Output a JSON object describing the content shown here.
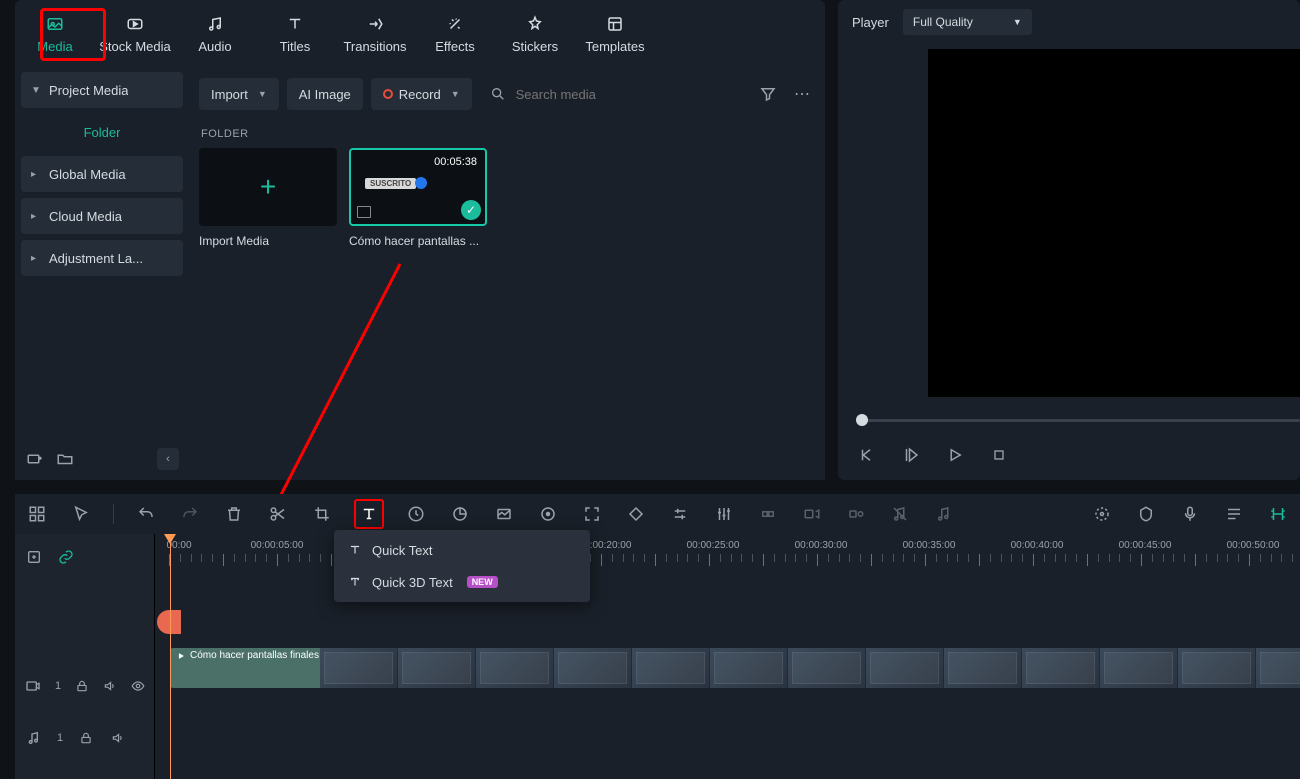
{
  "top_tabs": {
    "media": "Media",
    "stock_media": "Stock Media",
    "audio": "Audio",
    "titles": "Titles",
    "transitions": "Transitions",
    "effects": "Effects",
    "stickers": "Stickers",
    "templates": "Templates"
  },
  "sidebar": {
    "project_media": "Project Media",
    "folder": "Folder",
    "global_media": "Global Media",
    "cloud_media": "Cloud Media",
    "adjustment": "Adjustment La..."
  },
  "media_toolbar": {
    "import": "Import",
    "ai_image": "AI Image",
    "record": "Record",
    "search_placeholder": "Search media"
  },
  "media_section": {
    "folder_label": "FOLDER",
    "import_media": "Import Media",
    "clip1": {
      "name": "Cómo hacer pantallas ...",
      "duration": "00:05:38",
      "tag": "SUSCRITO"
    }
  },
  "player": {
    "label": "Player",
    "quality": "Full Quality"
  },
  "text_menu": {
    "quick_text": "Quick Text",
    "quick_3d": "Quick 3D Text",
    "new_badge": "NEW"
  },
  "ruler": {
    "marks": [
      "00:00",
      "00:00:05:00",
      "00:00:20:00",
      "00:00:25:00",
      "00:00:30:00",
      "00:00:35:00",
      "00:00:40:00",
      "00:00:45:00",
      "00:00:50:00"
    ]
  },
  "timeline": {
    "clip_label": "Cómo hacer pantallas finales",
    "video_track_index": "1",
    "audio_track_index": "1"
  }
}
